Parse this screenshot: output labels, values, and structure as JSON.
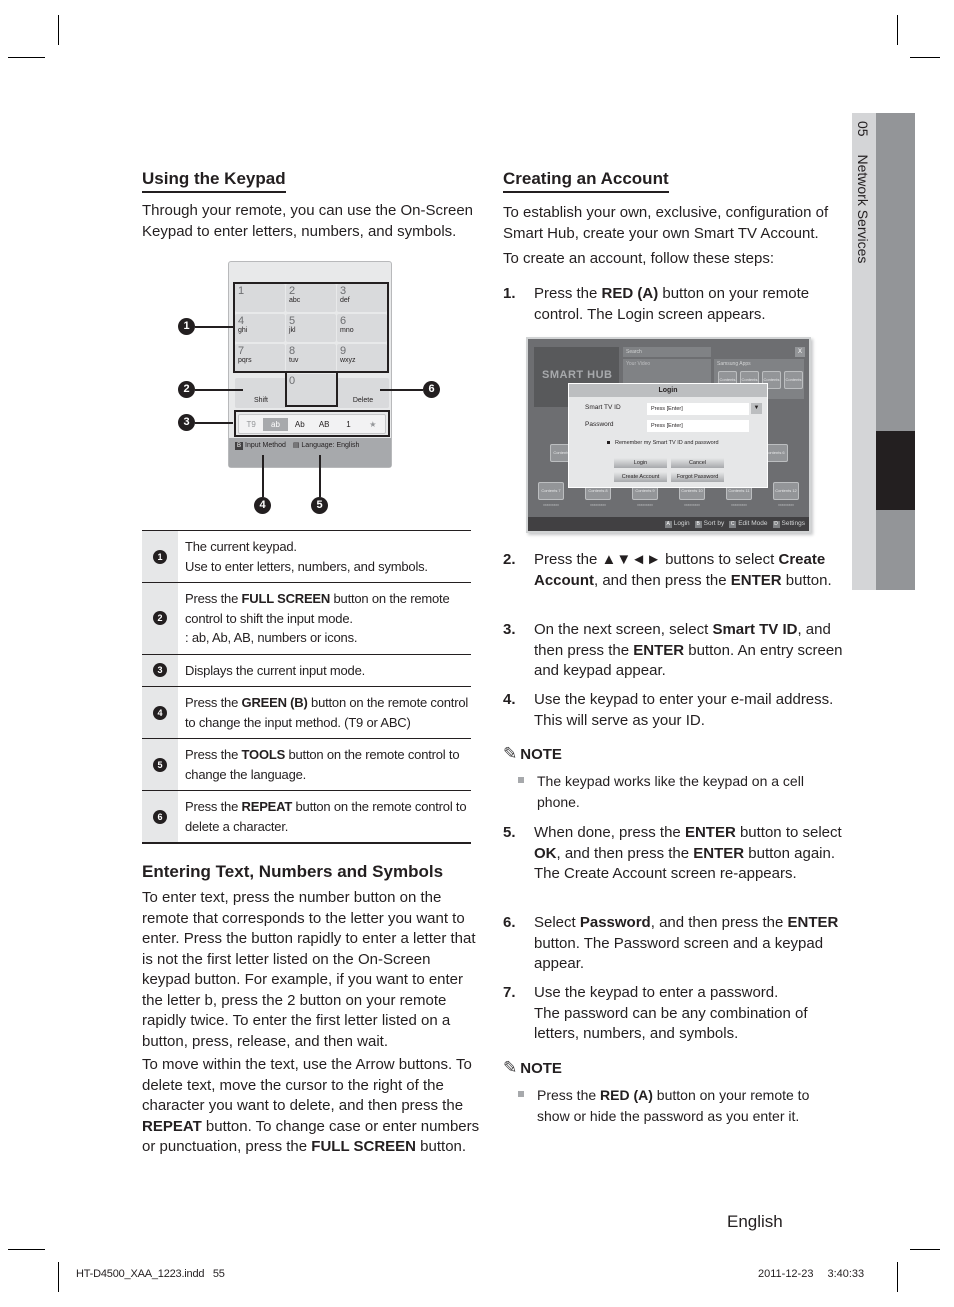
{
  "side_tab": {
    "chapter_number": "05",
    "chapter_title": "Network Services"
  },
  "left": {
    "keypad_section": {
      "title": "Using the Keypad",
      "intro": "Through your remote, you can use the On-Screen Keypad to enter letters, numbers, and symbols."
    },
    "keypad_figure": {
      "keys": [
        {
          "digit": "1",
          "letters": ""
        },
        {
          "digit": "2",
          "letters": "abc"
        },
        {
          "digit": "3",
          "letters": "def"
        },
        {
          "digit": "4",
          "letters": "ghi"
        },
        {
          "digit": "5",
          "letters": "jkl"
        },
        {
          "digit": "6",
          "letters": "mno"
        },
        {
          "digit": "7",
          "letters": "pqrs"
        },
        {
          "digit": "8",
          "letters": "tuv"
        },
        {
          "digit": "9",
          "letters": "wxyz"
        },
        {
          "digit": "0",
          "letters": ""
        }
      ],
      "shift_label": "Shift",
      "delete_label": "Delete",
      "modes": [
        "T9",
        "ab",
        "Ab",
        "AB",
        "1",
        "★"
      ],
      "selected_mode": "ab",
      "input_method_key": "B",
      "input_method_label": "Input Method",
      "language_label": "Language: English",
      "callouts": [
        "1",
        "2",
        "3",
        "4",
        "5",
        "6"
      ]
    },
    "table": [
      {
        "num": "1",
        "lines": [
          "The current keypad.",
          "Use to enter letters, numbers, and symbols."
        ]
      },
      {
        "num": "2",
        "pre": "Press the ",
        "bold": "FULL SCREEN",
        "post": " button on the remote control to shift the input mode.",
        "extra": ": ab, Ab, AB, numbers or icons."
      },
      {
        "num": "3",
        "text": "Displays the current input mode."
      },
      {
        "num": "4",
        "pre": "Press the ",
        "bold": "GREEN (B)",
        "post": " button on the remote control to change the input method. (T9 or ABC)"
      },
      {
        "num": "5",
        "pre": "Press the ",
        "bold": "TOOLS",
        "post": " button on the remote control to change the language."
      },
      {
        "num": "6",
        "pre": "Press the ",
        "bold": "REPEAT",
        "post": " button on the remote control to delete a character."
      }
    ],
    "entering_section": {
      "title": "Entering Text, Numbers and Symbols",
      "para1": "To enter text, press the number button on the remote that corresponds to the letter you want to enter. Press the button rapidly to enter a letter that is not the first letter listed on the On-Screen keypad button. For example, if you want to enter the letter b, press the 2 button on your remote rapidly twice. To enter the first letter listed on a button, press, release, and then wait.",
      "para2_a": "To move within the text, use the Arrow buttons. To delete text, move the cursor to the right of the character you want to delete, and then press the ",
      "para2_b1": "REPEAT",
      "para2_c": " button. To change case or enter numbers or punctuation, press the ",
      "para2_b2": "FULL SCREEN",
      "para2_d": " button."
    }
  },
  "right": {
    "title": "Creating an Account",
    "intro1": "To establish your own, exclusive, configuration of Smart Hub, create your own Smart TV Account.",
    "intro2": "To create an account, follow these steps:",
    "steps": [
      {
        "n": "1.",
        "parts": [
          [
            "Press the ",
            false
          ],
          [
            "RED (A)",
            true
          ],
          [
            " button on your remote control. The Login screen appears.",
            false
          ]
        ]
      },
      {
        "n": "2.",
        "parts": [
          [
            "Press the ▲▼◄► buttons to select ",
            false
          ],
          [
            "Create Account",
            true
          ],
          [
            ", and then press the ",
            false
          ],
          [
            "ENTER",
            true
          ],
          [
            " button.",
            false
          ]
        ]
      },
      {
        "n": "3.",
        "parts": [
          [
            "On the next screen, select ",
            false
          ],
          [
            "Smart TV ID",
            true
          ],
          [
            ", and then press the ",
            false
          ],
          [
            "ENTER",
            true
          ],
          [
            " button. An entry screen and keypad appear.",
            false
          ]
        ]
      },
      {
        "n": "4.",
        "parts": [
          [
            "Use the keypad to enter your e-mail address. This will serve as your ID.",
            false
          ]
        ]
      },
      {
        "n": "5.",
        "parts": [
          [
            "When done, press the ",
            false
          ],
          [
            "ENTER",
            true
          ],
          [
            " button to select ",
            false
          ],
          [
            "OK",
            true
          ],
          [
            ", and then press the ",
            false
          ],
          [
            "ENTER",
            true
          ],
          [
            " button again. The Create Account screen re-appears.",
            false
          ]
        ]
      },
      {
        "n": "6.",
        "parts": [
          [
            "Select ",
            false
          ],
          [
            "Password",
            true
          ],
          [
            ", and then press the ",
            false
          ],
          [
            "ENTER",
            true
          ],
          [
            " button. The Password screen and a keypad appear.",
            false
          ]
        ]
      },
      {
        "n": "7.",
        "parts": [
          [
            "Use the keypad to enter a password.\nThe password can be any combination of letters, numbers, and symbols.",
            false
          ]
        ]
      }
    ],
    "notes": [
      {
        "heading": "NOTE",
        "parts": [
          [
            "The keypad works like the keypad on a cell phone.",
            false
          ]
        ]
      },
      {
        "heading": "NOTE",
        "parts": [
          [
            "Press the ",
            false
          ],
          [
            "RED (A)",
            true
          ],
          [
            " button on your remote to show or hide the password as you enter it.",
            false
          ]
        ]
      }
    ],
    "smart_hub": {
      "logo": "SMART HUB",
      "search": "Search",
      "close": "X",
      "your_video": "Your Video",
      "samsung_apps": "Samsung Apps",
      "app_tiles": [
        "Contents 1",
        "Contents 2",
        "Contents 3",
        "Contents 4"
      ],
      "row1_tiles": [
        "Contents 5",
        "Contents 6"
      ],
      "row2_tiles": [
        "Contents 7",
        "Contents 8",
        "Contents 9",
        "Contents 10",
        "Contents 11",
        "Contents 12"
      ],
      "tile_caption": "xxxxxxxxx",
      "login_dialog": {
        "title": "Login",
        "id_label": "Smart TV ID",
        "id_value": "Press [Enter]",
        "password_label": "Password",
        "password_value": "Press [Enter]",
        "remember": "Remember my Smart TV ID and password",
        "buttons": [
          "Login",
          "Cancel",
          "Create Account",
          "Forgot Password"
        ]
      },
      "footer": [
        {
          "key": "A",
          "label": "Login"
        },
        {
          "key": "B",
          "label": "Sort by"
        },
        {
          "key": "C",
          "label": "Edit Mode"
        },
        {
          "key": "D",
          "label": "Settings"
        }
      ]
    }
  },
  "page_footer": {
    "language": "English",
    "file": "HT-D4500_XAA_1223.indd   55",
    "date": "2011-12-23",
    "time": "3:40:33"
  }
}
